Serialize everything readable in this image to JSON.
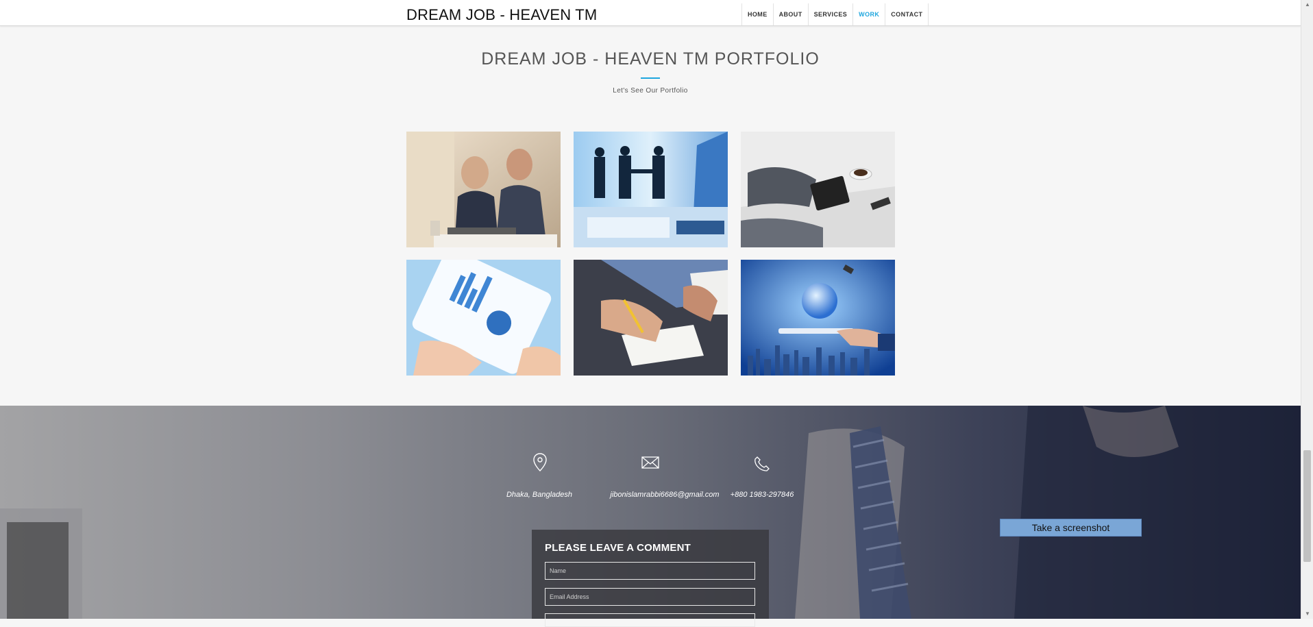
{
  "navbar": {
    "brand": "DREAM JOB - HEAVEN TM",
    "items": [
      {
        "label": "HOME"
      },
      {
        "label": "ABOUT"
      },
      {
        "label": "SERVICES"
      },
      {
        "label": "WORK",
        "active": true
      },
      {
        "label": "CONTACT"
      }
    ]
  },
  "portfolio": {
    "title": "DREAM JOB - HEAVEN TM  PORTFOLIO",
    "subtitle": "Let's See Our Portfolio",
    "accent_color": "#1ea6de"
  },
  "contact": {
    "location": {
      "icon": "map-pin-icon",
      "text": "Dhaka, Bangladesh"
    },
    "email": {
      "icon": "envelope-icon",
      "text": "jibonislamrabbi6686@gmail.com"
    },
    "phone": {
      "icon": "phone-icon",
      "text": "+880 1983-297846"
    }
  },
  "comment_form": {
    "title": "PLEASE LEAVE A COMMENT",
    "name_placeholder": "Name",
    "email_placeholder": "Email Address"
  },
  "screenshot_button": {
    "label": "Take a screenshot"
  }
}
